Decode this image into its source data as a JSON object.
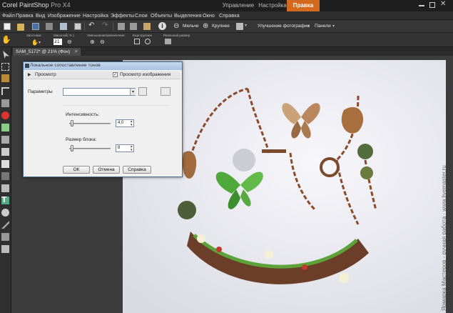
{
  "app": {
    "brand": "Corel",
    "product": "PaintShop",
    "version": "Pro X4"
  },
  "workspace_tabs": [
    {
      "label": "Управление"
    },
    {
      "label": "Настройка"
    },
    {
      "label": "Правка",
      "active": true
    }
  ],
  "menu": [
    "Файл",
    "Правка",
    "Вид",
    "Изображение",
    "Настройка",
    "Эффекты",
    "Слои",
    "Объекты",
    "Выделения",
    "Окно",
    "Справка"
  ],
  "toolbar": {
    "smaller_label": "Мельче",
    "larger_label": "Крупнее",
    "enhance_photo_label": "Улучшение фотографии",
    "panels_label": "Панели"
  },
  "tool_options": {
    "presets_label": "Заготовки",
    "zoom_label": "Масштаб( % )",
    "zoom_value": "21",
    "zoom_in_out_label": "Уменьшение/увеличение:",
    "more_larger_label": "Еще крупнее",
    "actual_size_label": "Реальный размер"
  },
  "document": {
    "tab_label": "SAM_5172* @ 21% (Фон)"
  },
  "dialog": {
    "title": "Локальное сопоставление тонов",
    "preview_label": "Просмотр",
    "image_preview_label": "Просмотр изображения",
    "image_preview_checked": true,
    "params_label": "Параметры",
    "params_value": "",
    "intensity_label": "Интенсивность:",
    "intensity_value": "4,0",
    "block_size_label": "Размер блока:",
    "block_size_value": "8",
    "ok_label": "ОК",
    "cancel_label": "Отмена",
    "help_label": "Справка"
  },
  "watermark": "Ярмарка Мастеров - ручная работа · www.livemaster.ru"
}
